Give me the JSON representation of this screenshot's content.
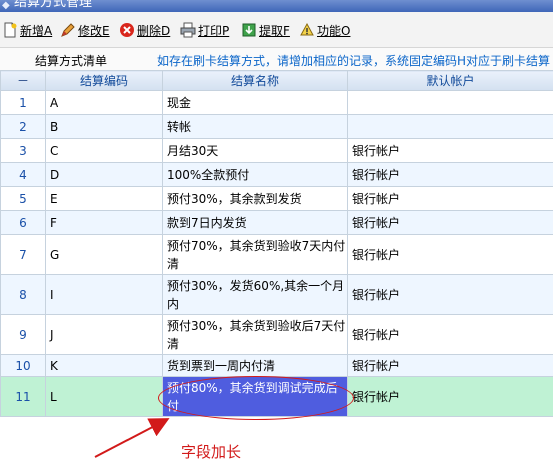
{
  "window": {
    "title": "结算方式管理"
  },
  "toolbar": {
    "add_label": "新增A",
    "edit_label": "修改E",
    "delete_label": "删除D",
    "print_label": "打印P",
    "extract_label": "提取F",
    "function_label": "功能O"
  },
  "info": {
    "list_title": "结算方式清单",
    "hint": "如存在刷卡结算方式，请增加相应的记录，系统固定编码H对应于刷卡结算"
  },
  "table": {
    "headers": [
      "－",
      "结算编码",
      "结算名称",
      "默认帐户"
    ],
    "rows": [
      {
        "num": "1",
        "code": "A",
        "name": "现金",
        "account": ""
      },
      {
        "num": "2",
        "code": "B",
        "name": "转帐",
        "account": ""
      },
      {
        "num": "3",
        "code": "C",
        "name": "月结30天",
        "account": "银行帐户"
      },
      {
        "num": "4",
        "code": "D",
        "name": "100%全款预付",
        "account": "银行帐户"
      },
      {
        "num": "5",
        "code": "E",
        "name": "预付30%，其余款到发货",
        "account": "银行帐户"
      },
      {
        "num": "6",
        "code": "F",
        "name": "款到7日内发货",
        "account": "银行帐户"
      },
      {
        "num": "7",
        "code": "G",
        "name": "预付70%，其余货到验收7天内付清",
        "account": "银行帐户"
      },
      {
        "num": "8",
        "code": "I",
        "name": "预付30%，发货60%,其余一个月内",
        "account": "银行帐户"
      },
      {
        "num": "9",
        "code": "J",
        "name": "预付30%，其余货到验收后7天付清",
        "account": "银行帐户"
      },
      {
        "num": "10",
        "code": "K",
        "name": "货到票到一周内付清",
        "account": "银行帐户"
      },
      {
        "num": "11",
        "code": "L",
        "name": "预付80%，其余货到调试完成后付",
        "account": "银行帐户"
      }
    ]
  },
  "annotation": {
    "text": "字段加长",
    "color": "#d21a1a"
  },
  "colors": {
    "selected_row": "#bff2d4",
    "selected_cell": "#4f5ddf",
    "header_text": "#114a9a",
    "hint_text": "#0c66c9"
  }
}
